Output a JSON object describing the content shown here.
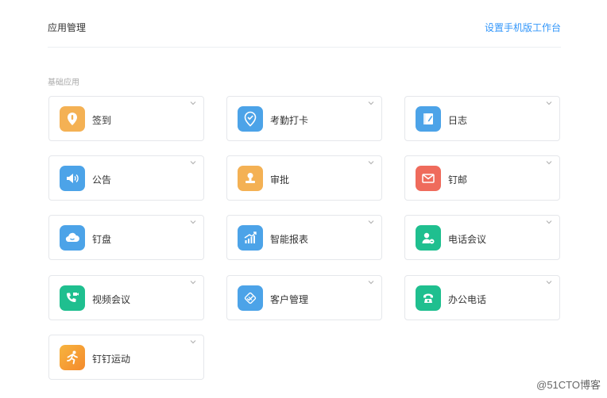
{
  "header": {
    "title": "应用管理",
    "link_label": "设置手机版工作台"
  },
  "section": {
    "label": "基础应用"
  },
  "apps": [
    {
      "name": "签到",
      "icon": "location-pin-icon",
      "color": "#f4b154"
    },
    {
      "name": "考勤打卡",
      "icon": "check-pin-icon",
      "color": "#4ca3e8"
    },
    {
      "name": "日志",
      "icon": "notebook-icon",
      "color": "#4ca3e8"
    },
    {
      "name": "公告",
      "icon": "speaker-icon",
      "color": "#4ca3e8"
    },
    {
      "name": "审批",
      "icon": "stamp-icon",
      "color": "#f4b154"
    },
    {
      "name": "钉邮",
      "icon": "mail-icon",
      "color": "#ef6b5c"
    },
    {
      "name": "钉盘",
      "icon": "cloud-icon",
      "color": "#4ca3e8"
    },
    {
      "name": "智能报表",
      "icon": "chart-icon",
      "color": "#4ca3e8"
    },
    {
      "name": "电话会议",
      "icon": "conference-call-icon",
      "color": "#1fbf8f"
    },
    {
      "name": "视频会议",
      "icon": "video-call-icon",
      "color": "#1fbf8f"
    },
    {
      "name": "客户管理",
      "icon": "handshake-icon",
      "color": "#4ca3e8"
    },
    {
      "name": "办公电话",
      "icon": "phone-icon",
      "color": "#1fbf8f"
    },
    {
      "name": "钉钉运动",
      "icon": "runner-icon",
      "color": "#f4a03a"
    }
  ],
  "watermark": "@51CTO博客"
}
